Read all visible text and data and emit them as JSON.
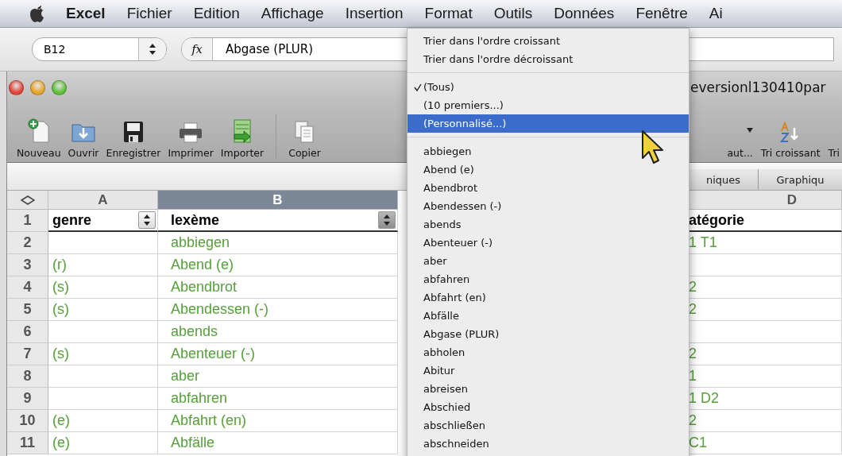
{
  "menu_bar": {
    "app": "Excel",
    "items": [
      "Fichier",
      "Edition",
      "Affichage",
      "Insertion",
      "Format",
      "Outils",
      "Données",
      "Fenêtre",
      "Ai"
    ]
  },
  "formula_bar": {
    "cell_reference": "B12",
    "function_label": "fx",
    "formula": "Abgase (PLUR)"
  },
  "window": {
    "title": "eversionl130410par"
  },
  "toolbar": {
    "items": [
      {
        "label": "Nouveau",
        "kind": "new"
      },
      {
        "label": "Ouvrir",
        "kind": "open"
      },
      {
        "label": "Enregistrer",
        "kind": "save"
      },
      {
        "label": "Imprimer",
        "kind": "print"
      },
      {
        "label": "Importer",
        "kind": "import"
      },
      {
        "label": "Copier",
        "kind": "copy"
      }
    ],
    "right_items": [
      {
        "label": "aut...",
        "kind": "dropdown"
      },
      {
        "label": "Tri croissant",
        "kind": "sort"
      },
      {
        "label": "Tri",
        "kind": "plain"
      }
    ]
  },
  "ribbon_tabs": [
    {
      "label": "niques"
    },
    {
      "label": "Graphiqu"
    }
  ],
  "sheet": {
    "columns": [
      {
        "label": "A",
        "selected": false
      },
      {
        "label": "B",
        "selected": true
      },
      {
        "label": "D",
        "selected": false
      }
    ],
    "filter_buttons": [
      {
        "active": false
      },
      {
        "active": true
      }
    ],
    "rows": [
      {
        "number": "1",
        "a": "genre",
        "b": "lexème",
        "d": "atégorie"
      },
      {
        "number": "2",
        "b": "abbiegen",
        "d": "1 T1"
      },
      {
        "number": "3",
        "a": "(r)",
        "b": "Abend (e)"
      },
      {
        "number": "4",
        "a": "(s)",
        "b": "Abendbrot",
        "d": "2"
      },
      {
        "number": "5",
        "a": "(s)",
        "b": "Abendessen (-)",
        "d": "2"
      },
      {
        "number": "6",
        "b": "abends"
      },
      {
        "number": "7",
        "a": "(s)",
        "b": "Abenteuer (-)",
        "d": "2"
      },
      {
        "number": "8",
        "b": "aber",
        "d": "1"
      },
      {
        "number": "9",
        "b": "abfahren",
        "d": "1 D2"
      },
      {
        "number": "10",
        "a": "(e)",
        "b": "Abfahrt (en)",
        "d": "2"
      },
      {
        "number": "11",
        "a": "(e)",
        "b": "Abfälle",
        "d": "C1"
      }
    ]
  },
  "filter_menu": {
    "sort_items": [
      "Trier dans l'ordre croissant",
      "Trier dans l'ordre décroissant"
    ],
    "options": [
      {
        "label": "(Tous)",
        "checked": true,
        "selected": false
      },
      {
        "label": "(10 premiers...)",
        "checked": false,
        "selected": false
      },
      {
        "label": "(Personnalisé...)",
        "checked": false,
        "selected": true
      }
    ],
    "values": [
      "abbiegen",
      "Abend (e)",
      "Abendbrot",
      "Abendessen (-)",
      "abends",
      "Abenteuer (-)",
      "aber",
      "abfahren",
      "Abfahrt (en)",
      "Abfälle",
      "Abgase (PLUR)",
      "abholen",
      "Abitur",
      "abreisen",
      "Abschied",
      "abschließen",
      "abschneiden"
    ]
  }
}
